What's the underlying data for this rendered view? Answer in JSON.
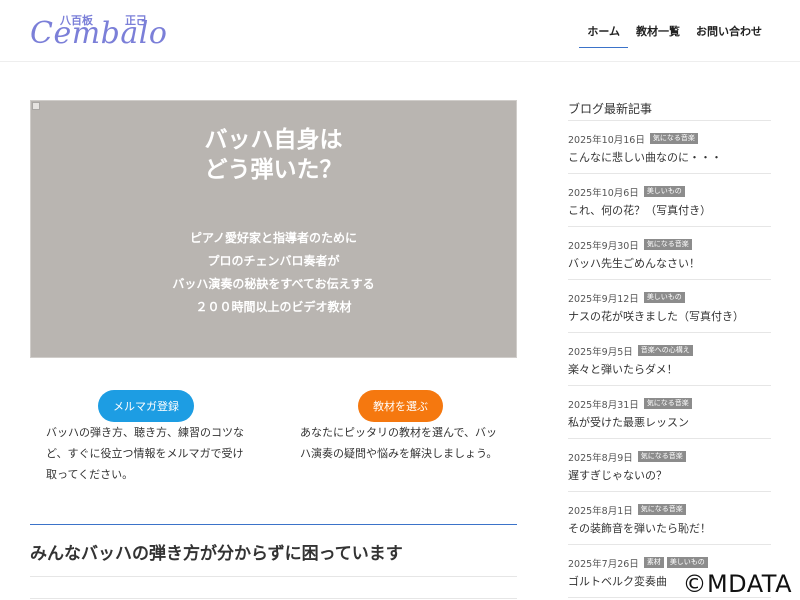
{
  "header": {
    "logo": {
      "script": "Cembalo",
      "jp_left": "八百板",
      "jp_right": "正己"
    },
    "nav": [
      {
        "label": "ホーム",
        "active": true
      },
      {
        "label": "教材一覧",
        "active": false
      },
      {
        "label": "お問い合わせ",
        "active": false
      }
    ]
  },
  "hero": {
    "title_line1": "バッハ自身は",
    "title_line2": "どう弾いた？",
    "lines": [
      "ピアノ愛好家と指導者のために",
      "プロのチェンバロ奏者が",
      "バッハ演奏の秘訣をすべてお伝えする",
      "２００時間以上のビデオ教材"
    ]
  },
  "cta": {
    "left": {
      "label": "メルマガ登録",
      "text": "バッハの弾き方、聴き方、練習のコツなど、すぐに役立つ情報をメルマガで受け取ってください。"
    },
    "right": {
      "label": "教材を選ぶ",
      "text": "あなたにピッタリの教材を選んで、バッハ演奏の疑問や悩みを解決しましょう。"
    }
  },
  "section": {
    "title": "みんなバッハの弾き方が分からずに困っています"
  },
  "sidebar": {
    "title": "ブログ最新記事",
    "posts": [
      {
        "date": "2025年10月16日",
        "tags": [
          "気になる音楽"
        ],
        "title": "こんなに悲しい曲なのに・・・"
      },
      {
        "date": "2025年10月6日",
        "tags": [
          "美しいもの"
        ],
        "title": "これ、何の花？（写真付き）"
      },
      {
        "date": "2025年9月30日",
        "tags": [
          "気になる音楽"
        ],
        "title": "バッハ先生ごめんなさい！"
      },
      {
        "date": "2025年9月12日",
        "tags": [
          "美しいもの"
        ],
        "title": "ナスの花が咲きました（写真付き）"
      },
      {
        "date": "2025年9月5日",
        "tags": [
          "音楽への心構え"
        ],
        "title": "楽々と弾いたらダメ！"
      },
      {
        "date": "2025年8月31日",
        "tags": [
          "気になる音楽"
        ],
        "title": "私が受けた最悪レッスン"
      },
      {
        "date": "2025年8月9日",
        "tags": [
          "気になる音楽"
        ],
        "title": "遅すぎじゃないの？"
      },
      {
        "date": "2025年8月1日",
        "tags": [
          "気になる音楽"
        ],
        "title": "その装飾音を弾いたら恥だ！"
      },
      {
        "date": "2025年7月26日",
        "tags": [
          "素材",
          "美しいもの"
        ],
        "title": "ゴルトベルク変奏曲"
      }
    ]
  },
  "watermark": "©MDATA"
}
